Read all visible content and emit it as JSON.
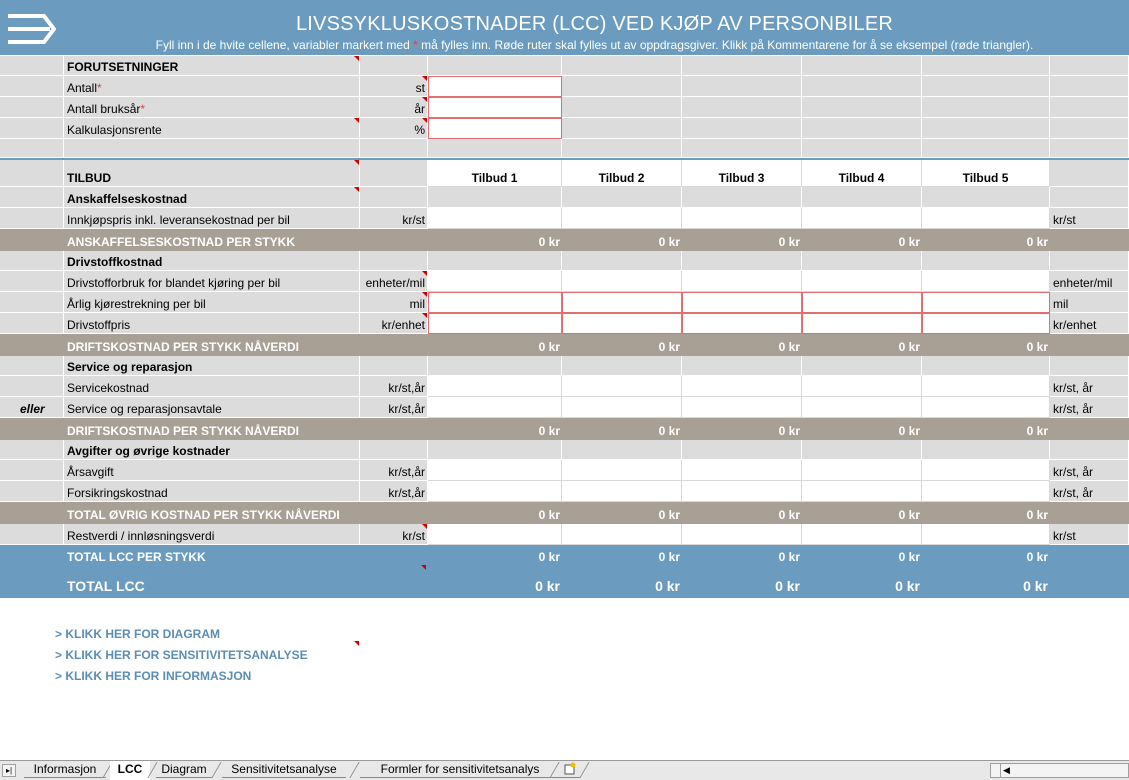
{
  "header": {
    "title": "LIVSSYKLUSKOSTNADER (LCC) VED KJØP AV PERSONBILER",
    "subtitle_pre": "Fyll inn i de hvite cellene, variabler markert med ",
    "subtitle_star": "*",
    "subtitle_post": " må fylles inn. Røde ruter skal fylles ut av oppdragsgiver. Klikk på Kommentarene for å se eksempel (røde triangler)."
  },
  "forutsetninger": {
    "heading": "FORUTSETNINGER",
    "rows": [
      {
        "label": "Antall",
        "star": "*",
        "unit": "st"
      },
      {
        "label": "Antall bruksår",
        "star": "*",
        "unit": "år"
      },
      {
        "label": "Kalkulasjonsrente",
        "star": "",
        "unit": "%"
      }
    ]
  },
  "tilbud": {
    "heading": "TILBUD",
    "columns": [
      "Tilbud 1",
      "Tilbud 2",
      "Tilbud 3",
      "Tilbud 4",
      "Tilbud 5"
    ]
  },
  "anskaffelse": {
    "heading": "Anskaffelseskostnad",
    "row": {
      "label": "Innkjøpspris inkl. leveransekostnad per bil",
      "unit": "kr/st",
      "unit_right": "kr/st"
    },
    "total": {
      "label": "ANSKAFFELSESKOSTNAD PER STYKK",
      "values": [
        "0 kr",
        "0 kr",
        "0 kr",
        "0 kr",
        "0 kr"
      ]
    }
  },
  "drivstoff": {
    "heading": "Drivstoffkostnad",
    "rows": [
      {
        "label": "Drivstofforbruk for blandet kjøring per bil",
        "unit": "enheter/mil",
        "unit_right": "enheter/mil"
      },
      {
        "label": "Årlig kjørestrekning per bil",
        "unit": "mil",
        "unit_right": "mil"
      },
      {
        "label": "Drivstoffpris",
        "unit": "kr/enhet",
        "unit_right": "kr/enhet"
      }
    ],
    "total": {
      "label": "DRIFTSKOSTNAD PER STYKK NÅVERDI",
      "values": [
        "0 kr",
        "0 kr",
        "0 kr",
        "0 kr",
        "0 kr"
      ]
    }
  },
  "service": {
    "heading": "Service og reparasjon",
    "rows": [
      {
        "prefix": "",
        "label": "Servicekostnad",
        "unit": "kr/st,år",
        "unit_right": "kr/st, år"
      },
      {
        "prefix": "eller",
        "label": "Service og reparasjonsavtale",
        "unit": "kr/st,år",
        "unit_right": "kr/st, år"
      }
    ],
    "total": {
      "label": "DRIFTSKOSTNAD PER STYKK NÅVERDI",
      "values": [
        "0 kr",
        "0 kr",
        "0 kr",
        "0 kr",
        "0 kr"
      ]
    }
  },
  "avgifter": {
    "heading": "Avgifter og øvrige kostnader",
    "rows": [
      {
        "label": "Årsavgift",
        "unit": "kr/st,år",
        "unit_right": "kr/st, år"
      },
      {
        "label": "Forsikringskostnad",
        "unit": "kr/st,år",
        "unit_right": "kr/st, år"
      }
    ],
    "total": {
      "label": "TOTAL ØVRIG KOSTNAD PER STYKK NÅVERDI",
      "values": [
        "0 kr",
        "0 kr",
        "0 kr",
        "0 kr",
        "0 kr"
      ]
    }
  },
  "restverdi": {
    "label": "Restverdi / innløsningsverdi",
    "unit": "kr/st",
    "unit_right": "kr/st"
  },
  "total_lcc_stykk": {
    "label": "TOTAL LCC PER STYKK",
    "values": [
      "0 kr",
      "0 kr",
      "0 kr",
      "0 kr",
      "0 kr"
    ]
  },
  "total_lcc": {
    "label": "TOTAL LCC",
    "values": [
      "0 kr",
      "0 kr",
      "0 kr",
      "0 kr",
      "0 kr"
    ]
  },
  "links": [
    "> KLIKK HER FOR DIAGRAM",
    "> KLIKK HER FOR SENSITIVITETSANALYSE",
    "> KLIKK HER FOR INFORMASJON"
  ],
  "sheet_tabs": [
    "Informasjon",
    "LCC",
    "Diagram",
    "Sensitivitetsanalyse",
    "Formler for sensitivitetsanalys"
  ],
  "active_tab": "LCC",
  "colors": {
    "header_blue": "#6b9cbf",
    "band_taupe": "#a89f95",
    "grid_gray": "#dcdcdc",
    "required_red": "#e07070",
    "link_blue": "#5b8db5"
  }
}
